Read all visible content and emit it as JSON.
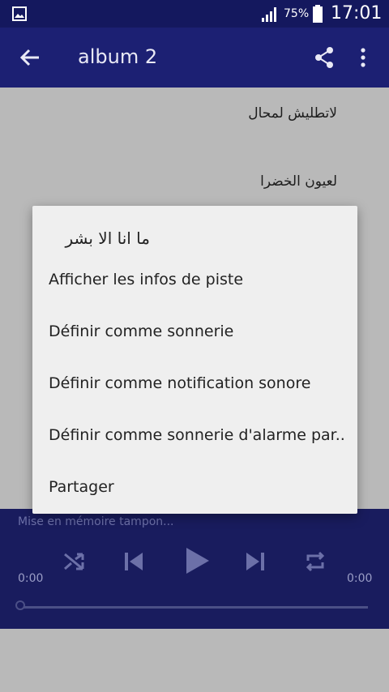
{
  "status_bar": {
    "battery_percent": "75%",
    "clock": "17:01"
  },
  "app_bar": {
    "title": "album 2"
  },
  "tracks": [
    "لاتطليش لمحال",
    "لعيون الخضرا"
  ],
  "player": {
    "buffer_text": "Mise en mémoire tampon...",
    "time_elapsed": "0:00",
    "time_total": "0:00",
    "progress": 0
  },
  "dialog": {
    "title": "ما انا الا بشر",
    "items": [
      "Afficher les infos de piste",
      "Définir comme sonnerie",
      "Définir comme notification sonore",
      "Définir comme sonnerie d'alarme par..",
      "Partager"
    ]
  },
  "colors": {
    "status_bar": "#14185e",
    "app_bar": "#1c2073",
    "player": "#191c5e",
    "dim_background": "#b9b9b9",
    "dialog": "#efefef"
  },
  "icons": [
    "gallery-icon",
    "signal-icon",
    "battery-icon",
    "arrow-back-icon",
    "share-icon",
    "more-vert-icon",
    "shuffle-icon",
    "skip-previous-icon",
    "play-icon",
    "skip-next-icon",
    "repeat-icon"
  ]
}
